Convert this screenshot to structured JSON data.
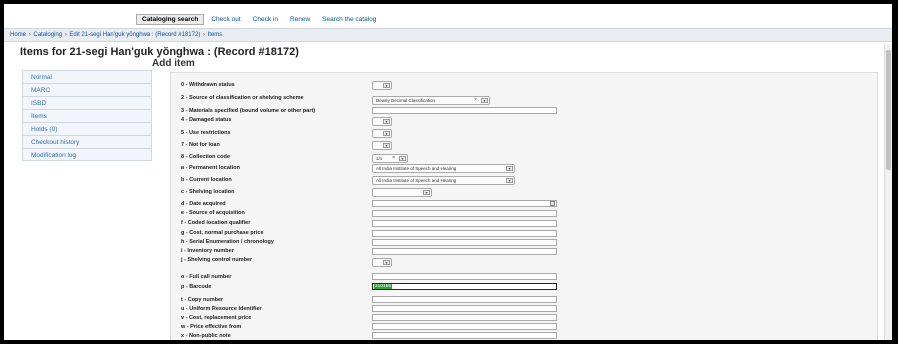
{
  "topnav": {
    "tabs": [
      {
        "label": "Cataloging search",
        "active": true
      },
      {
        "label": "Check out",
        "active": false
      },
      {
        "label": "Check in",
        "active": false
      },
      {
        "label": "Renew",
        "active": false
      },
      {
        "label": "Search the catalog",
        "active": false
      }
    ]
  },
  "breadcrumb": {
    "items": [
      "Home",
      "Cataloging",
      "Edit 21-segi Han'guk yŏnghwa : (Record #18172)",
      "Items"
    ],
    "separator": "›"
  },
  "page_title": "Items for 21-segi Han'guk yŏnghwa : (Record #18172)",
  "sub_title": "Add item",
  "sidemenu": {
    "items": [
      "Normal",
      "MARC",
      "ISBD",
      "Items",
      "Holds (0)",
      "Checkout history",
      "Modification log"
    ]
  },
  "form": {
    "withdrawn": {
      "label": "0 - Withdrawn status"
    },
    "source_classification": {
      "label": "2 - Source of classification or shelving scheme",
      "value": "Dewey Decimal Classification",
      "clear": "×"
    },
    "materials_specified": {
      "label": "3 - Materials specified (bound volume or other part)"
    },
    "damaged": {
      "label": "4 - Damaged status"
    },
    "use_restrictions": {
      "label": "5 - Use restrictions"
    },
    "not_for_loan": {
      "label": "7 - Not for loan"
    },
    "collection_code": {
      "label": "8 - Collection code",
      "value": "1/1",
      "clear": "×"
    },
    "permanent_location": {
      "label": "a - Permanent location",
      "value": "All India Institute of Speech and Hearing"
    },
    "current_location": {
      "label": "b - Current location",
      "value": "All India Institute of Speech and Hearing"
    },
    "shelving_location": {
      "label": "c - Shelving location"
    },
    "date_acquired": {
      "label": "d - Date acquired"
    },
    "source_acquisition": {
      "label": "e - Source of acquisition"
    },
    "coded_location": {
      "label": "f - Coded location qualifier"
    },
    "cost_normal": {
      "label": "g - Cost, normal purchase price"
    },
    "serial_enumeration": {
      "label": "h - Serial Enumeration / chronology"
    },
    "inventory_number": {
      "label": "i - Inventory number"
    },
    "shelving_control": {
      "label": "j - Shelving control number"
    },
    "full_call_number": {
      "label": "o - Full call number"
    },
    "barcode": {
      "label": "p - Barcode",
      "value": "210156"
    },
    "copy_number": {
      "label": "t - Copy number"
    },
    "uri": {
      "label": "u - Uniform Resource Identifier"
    },
    "cost_replacement": {
      "label": "v - Cost, replacement price"
    },
    "price_effective": {
      "label": "w - Price effective from"
    },
    "non_public_note": {
      "label": "x - Non-public note"
    }
  },
  "colors": {
    "link": "#0a54a0",
    "menu_link": "#2f6fb1",
    "barcode_highlight": "#2ea336"
  }
}
